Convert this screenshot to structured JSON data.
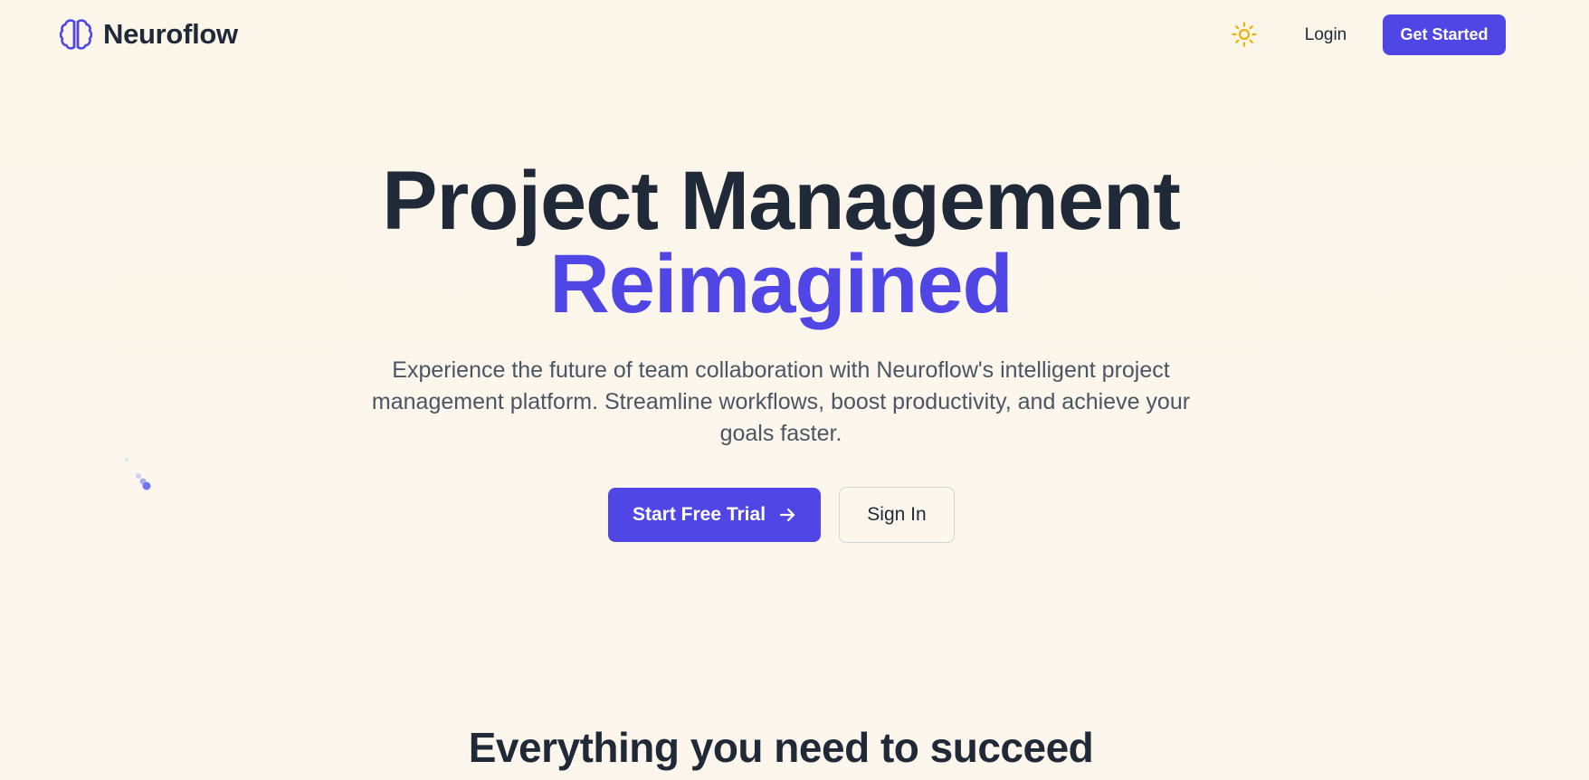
{
  "header": {
    "brand_name": "Neuroflow",
    "brand_icon": "brain-icon",
    "theme_icon": "sun-icon",
    "login_label": "Login",
    "get_started_label": "Get Started"
  },
  "hero": {
    "title_line1": "Project Management",
    "title_line2": "Reimagined",
    "description": "Experience the future of team collaboration with Neuroflow's intelligent project management platform. Streamline workflows, boost productivity, and achieve your goals faster.",
    "primary_cta_label": "Start Free Trial",
    "primary_cta_icon": "arrow-right-icon",
    "secondary_cta_label": "Sign In"
  },
  "features": {
    "section_title": "Everything you need to succeed"
  },
  "colors": {
    "accent": "#4f46e5",
    "heading": "#1f2937",
    "body_text": "#4b5563",
    "background": "#fcf6ec",
    "sun": "#eab308"
  }
}
